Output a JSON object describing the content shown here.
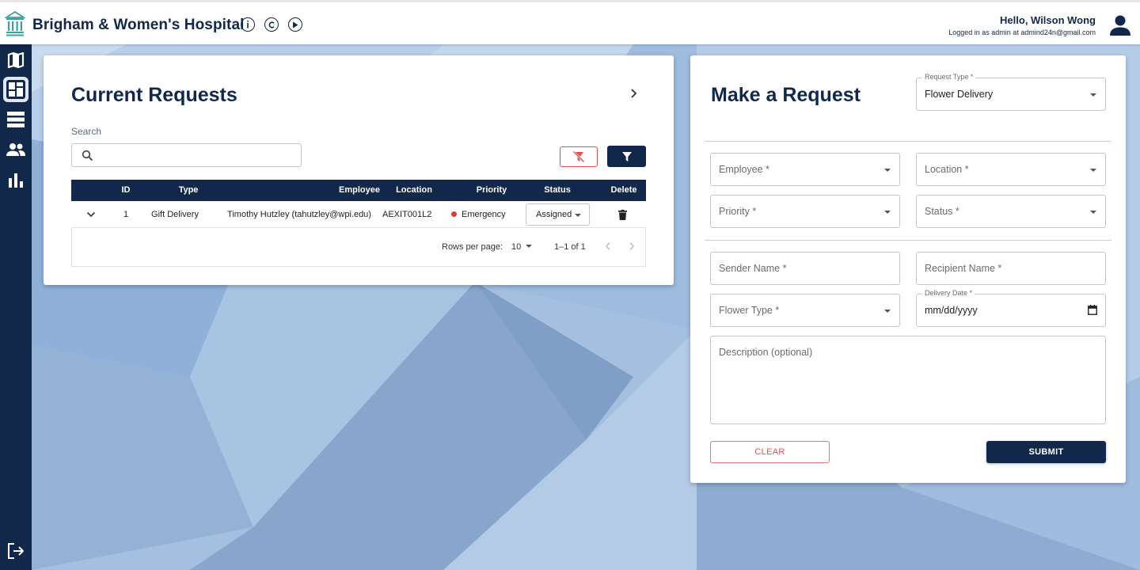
{
  "header": {
    "title": "Brigham & Women's Hospital",
    "about_icon": "info-icon",
    "credits_icon": "copyright-icon",
    "play_icon": "play-circle-icon",
    "greeting": "Hello, Wilson Wong",
    "logged_in": "Logged in as admin at admind24n@gmail.com"
  },
  "sidebar": {
    "items": [
      {
        "icon": "map-icon",
        "active": false
      },
      {
        "icon": "dashboard-icon",
        "active": true
      },
      {
        "icon": "list-icon",
        "active": false
      },
      {
        "icon": "people-icon",
        "active": false
      },
      {
        "icon": "bar-chart-icon",
        "active": false
      }
    ],
    "logout_icon": "logout-icon"
  },
  "requests": {
    "title": "Current Requests",
    "search_label": "Search",
    "search_placeholder": "",
    "columns": [
      "ID",
      "Type",
      "Employee",
      "Location",
      "Priority",
      "Status",
      "Delete"
    ],
    "rows": [
      {
        "id": "1",
        "type": "Gift Delivery",
        "employee": "Timothy Hutzley (tahutzley@wpi.edu)",
        "location": "AEXIT001L2",
        "priority": "Emergency",
        "status": "Assigned"
      }
    ],
    "rows_per_page_label": "Rows per page:",
    "rows_per_page": "10",
    "range": "1–1 of 1"
  },
  "form": {
    "title": "Make a Request",
    "request_type_label": "Request Type *",
    "request_type_value": "Flower Delivery",
    "employee": "Employee *",
    "location": "Location *",
    "priority": "Priority *",
    "status": "Status *",
    "sender_name": "Sender Name *",
    "recipient_name": "Recipient Name *",
    "flower_type": "Flower Type *",
    "delivery_date_label": "Delivery Date *",
    "delivery_date_value": "mm/dd/yyyy",
    "description": "Description (optional)",
    "clear_label": "CLEAR",
    "submit_label": "SUBMIT"
  },
  "colors": {
    "navy": "#12284b",
    "danger": "#d9534f",
    "emergency_dot": "#e53935",
    "background": "#a9c4e4"
  }
}
